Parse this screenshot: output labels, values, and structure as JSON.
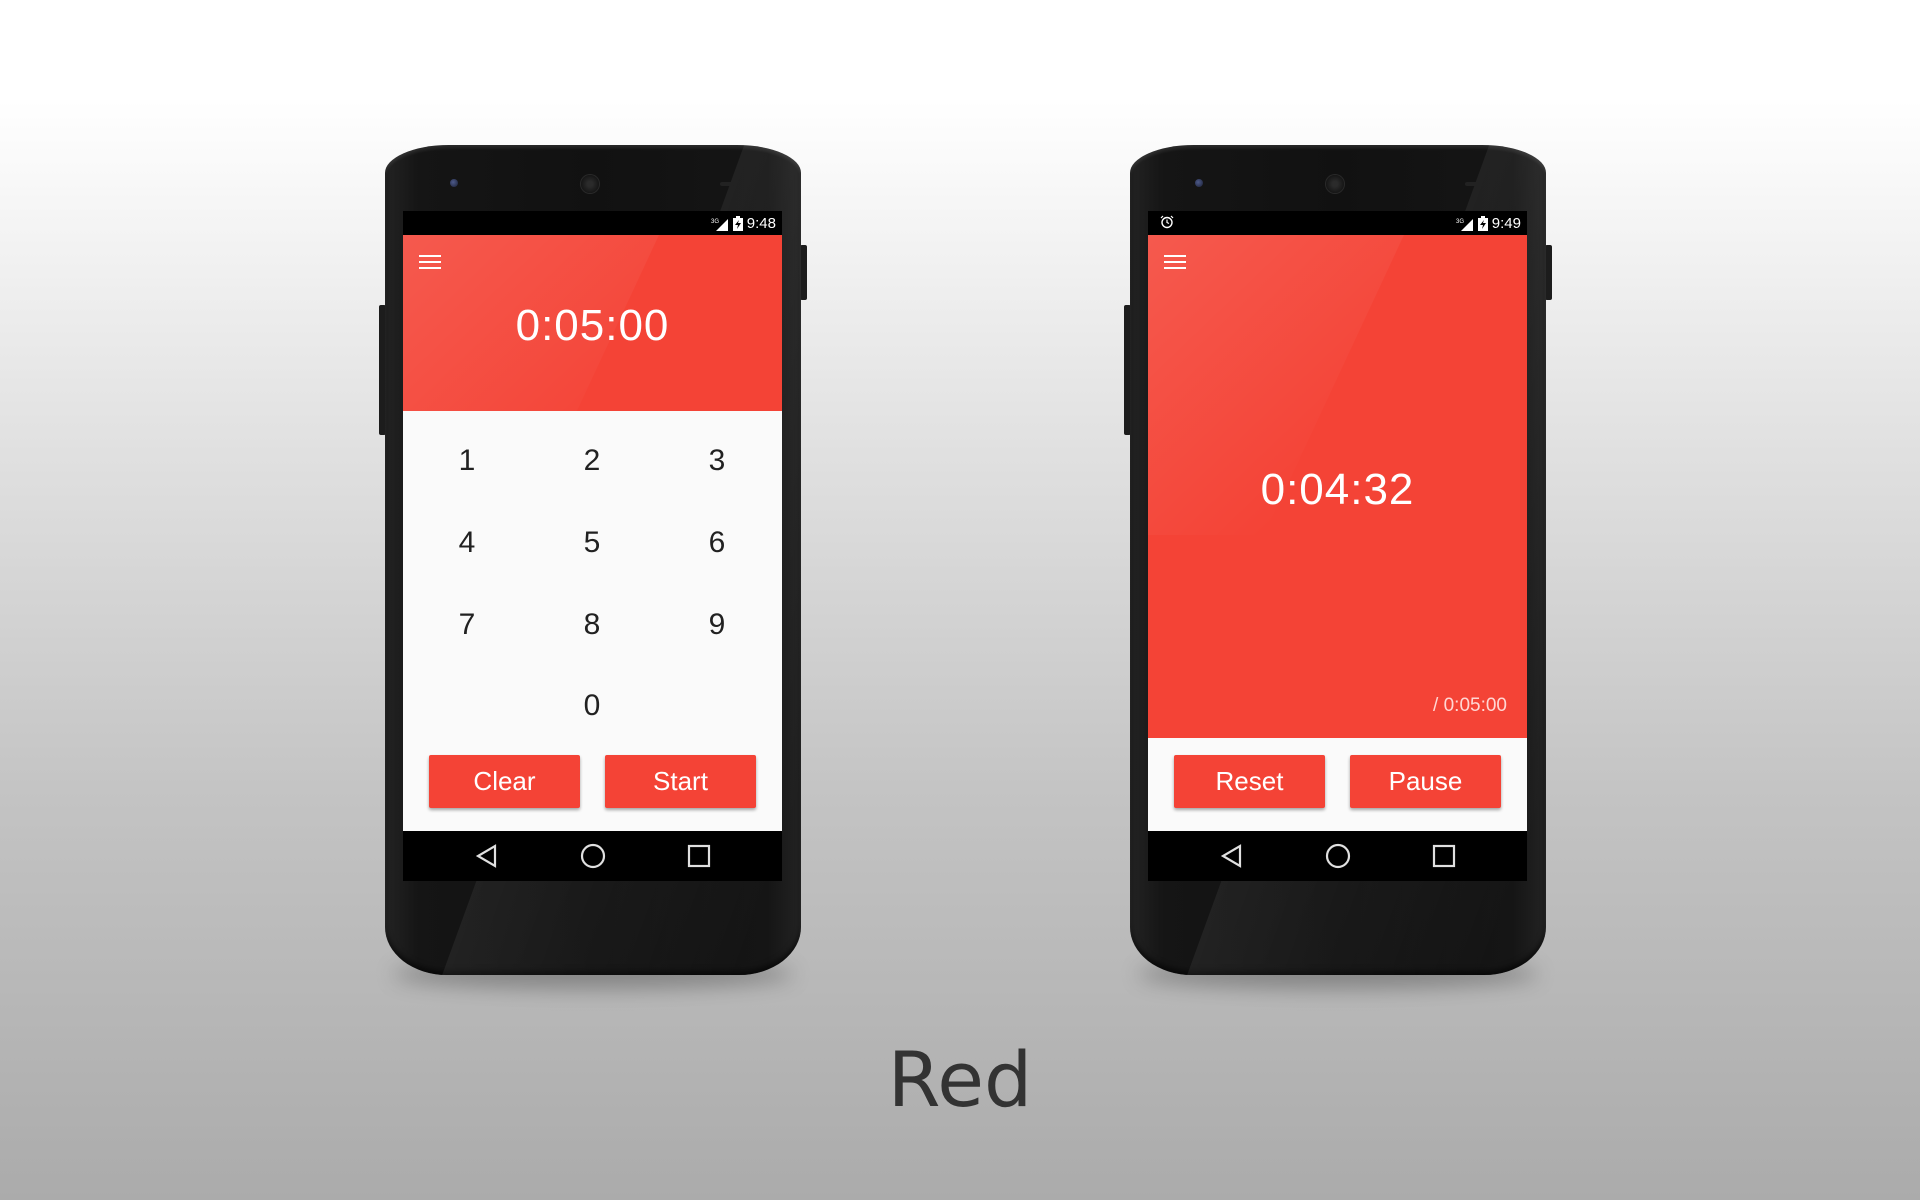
{
  "caption": "Red",
  "colors": {
    "accent": "#f44336",
    "screen_background": "#fafafa",
    "phone_body": "#111111",
    "caption_text": "#333333"
  },
  "left_phone": {
    "status_bar": {
      "time": "9:48",
      "icons": [
        "signal-3g-icon",
        "battery-charging-icon"
      ]
    },
    "menu_icon": "hamburger-menu-icon",
    "timer_display": "0:05:00",
    "keypad": {
      "keys": [
        "1",
        "2",
        "3",
        "4",
        "5",
        "6",
        "7",
        "8",
        "9",
        "0"
      ]
    },
    "buttons": {
      "clear_label": "Clear",
      "start_label": "Start"
    },
    "nav": [
      "back-icon",
      "home-icon",
      "recents-icon"
    ]
  },
  "right_phone": {
    "status_bar": {
      "time": "9:49",
      "icons": [
        "alarm-icon",
        "signal-3g-icon",
        "battery-charging-icon"
      ]
    },
    "menu_icon": "hamburger-menu-icon",
    "remaining_time": "0:04:32",
    "total_time": "/ 0:05:00",
    "buttons": {
      "reset_label": "Reset",
      "pause_label": "Pause"
    },
    "nav": [
      "back-icon",
      "home-icon",
      "recents-icon"
    ]
  }
}
